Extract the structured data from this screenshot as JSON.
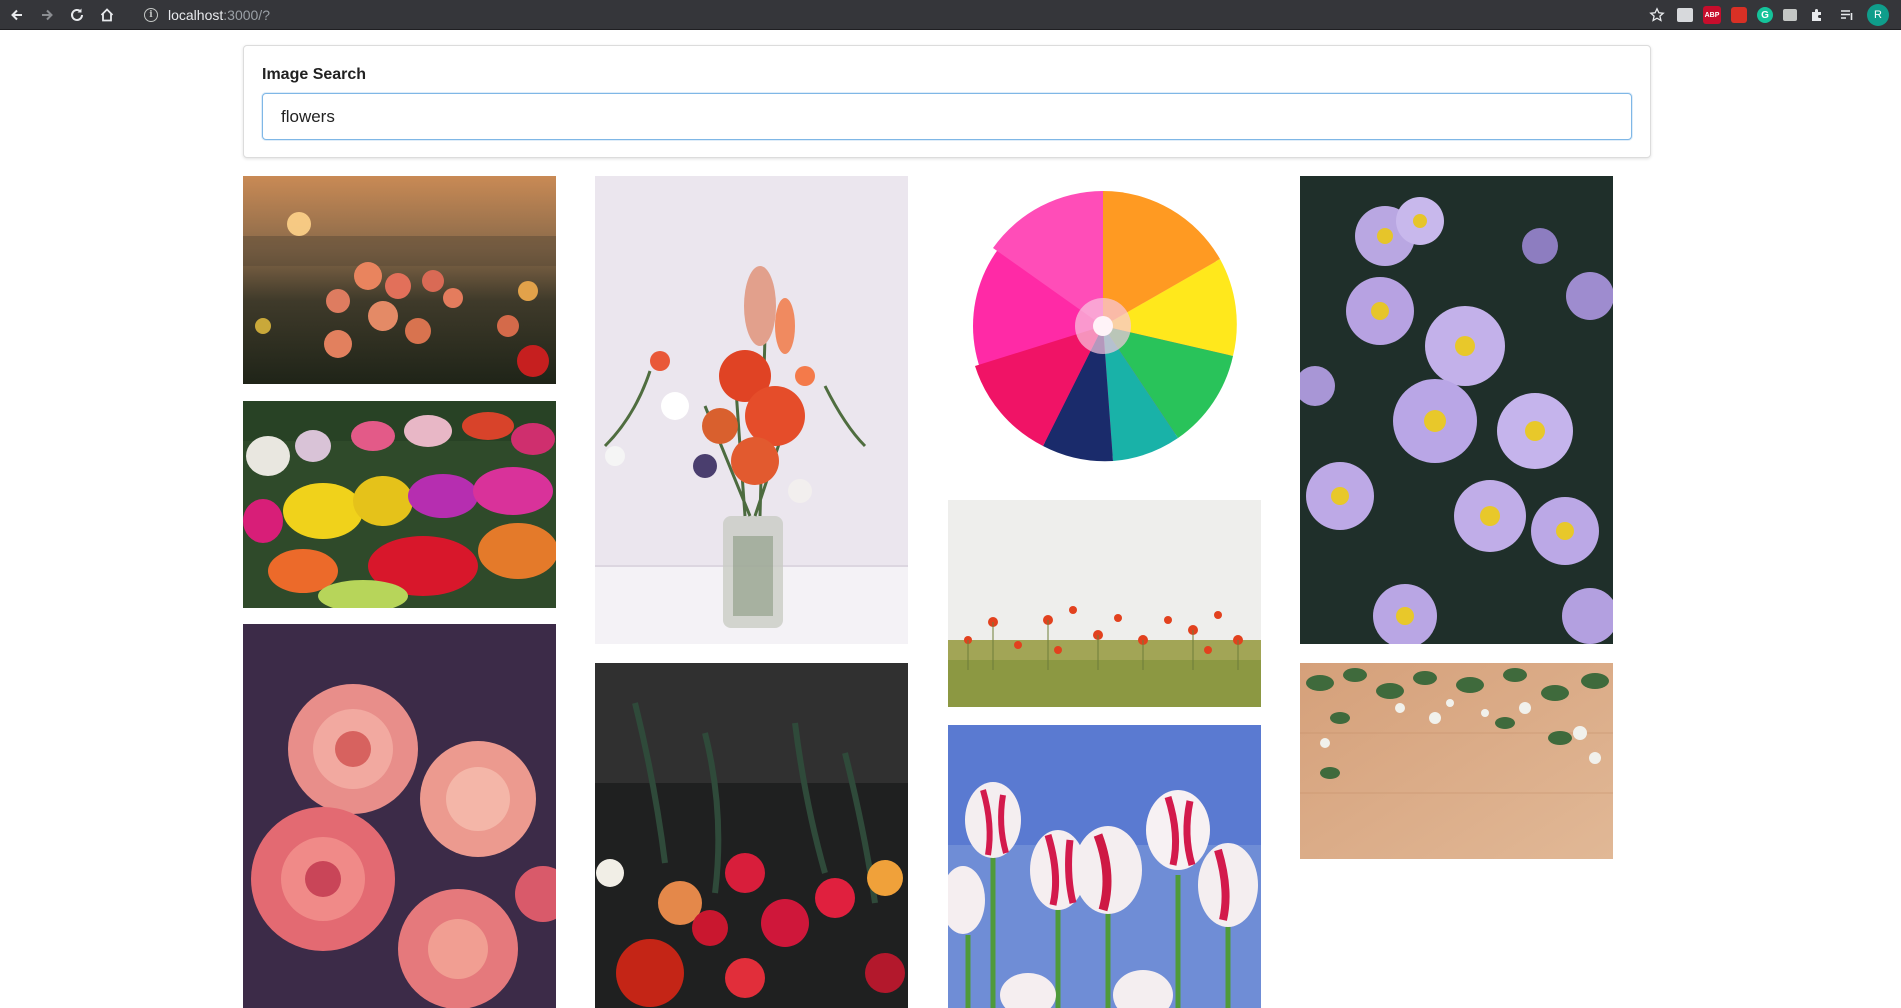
{
  "browser": {
    "url_host": "localhost",
    "url_rest": ":3000/?",
    "extensions": {
      "abp_label": "ABP",
      "grammarly_label": "G",
      "avatar_initial": "R"
    },
    "icons": [
      "back-arrow-icon",
      "forward-arrow-icon",
      "reload-icon",
      "home-icon",
      "info-icon",
      "star-icon",
      "puzzle-icon",
      "queue-icon"
    ]
  },
  "search": {
    "label": "Image Search",
    "value": "flowers"
  },
  "colors": {
    "input_border": "#7fb7e6",
    "chrome_bg": "#35363a"
  },
  "results": [
    {
      "subject": "sunset-flower-field"
    },
    {
      "subject": "tulip-market"
    },
    {
      "subject": "pink-roses"
    },
    {
      "subject": "bouquet-in-jar"
    },
    {
      "subject": "dark-bouquet"
    },
    {
      "subject": "rainbow-chrysanthemum"
    },
    {
      "subject": "poppy-field"
    },
    {
      "subject": "red-white-tulips"
    },
    {
      "subject": "purple-asters"
    },
    {
      "subject": "wood-with-flowers"
    }
  ]
}
